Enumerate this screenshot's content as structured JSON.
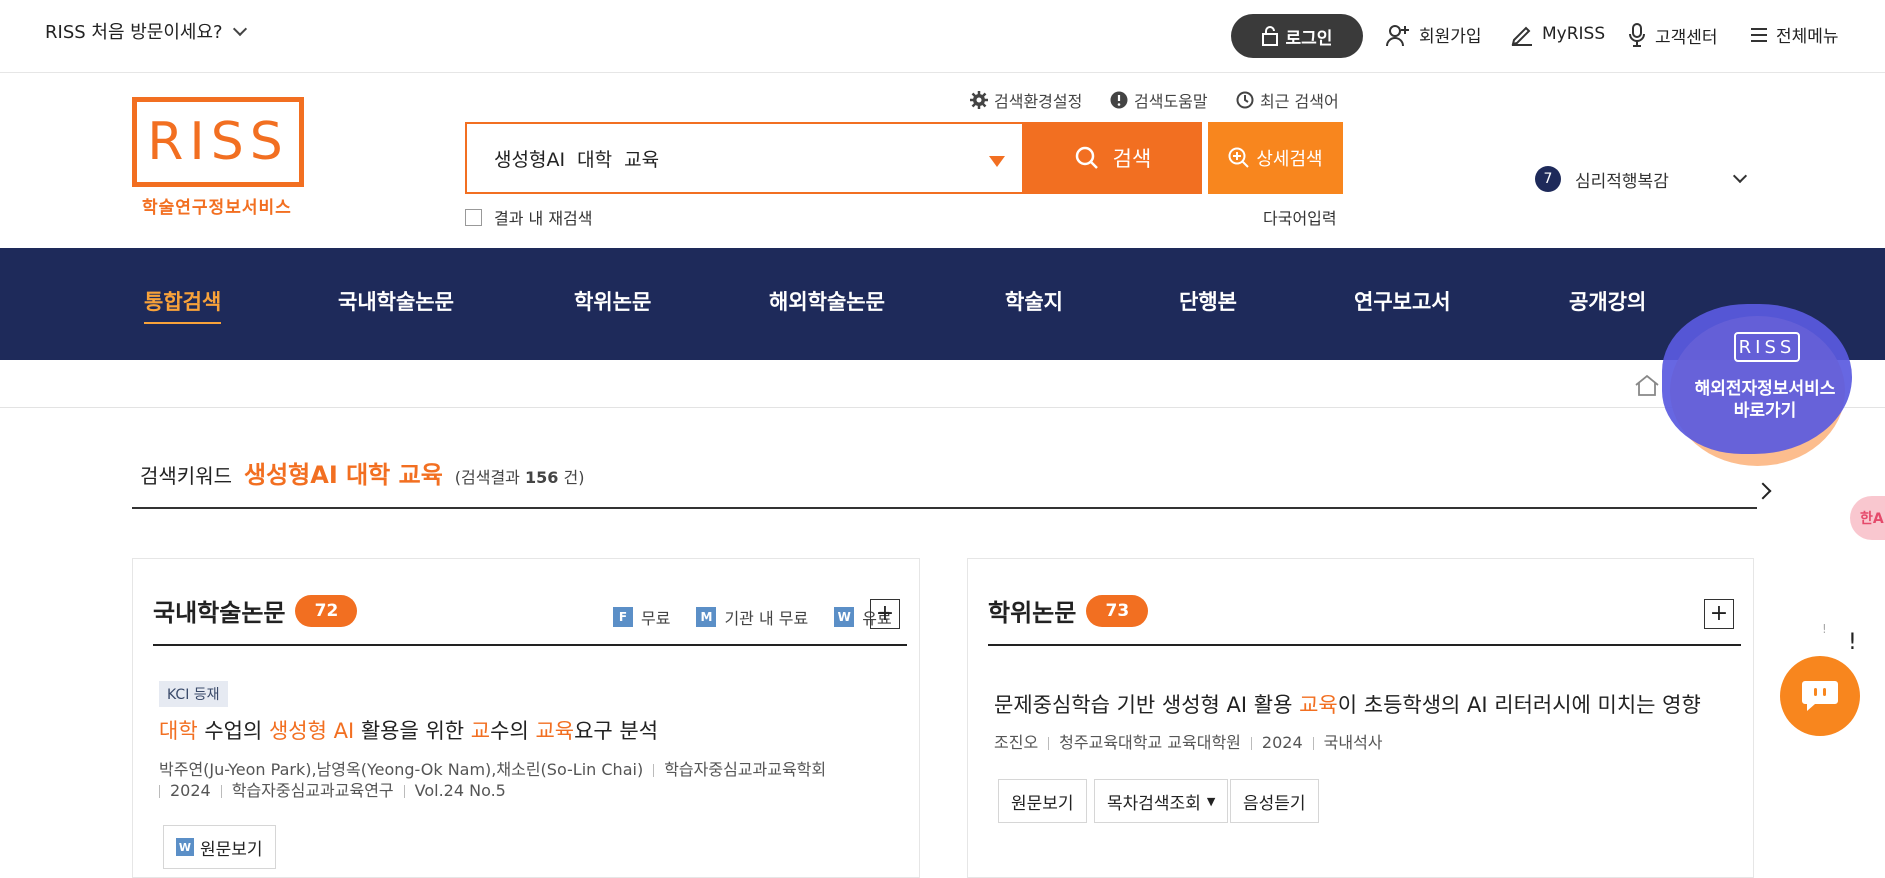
{
  "utility": {
    "first_visit": "RISS 처음 방문이세요?",
    "login": "로그인",
    "signup": "회원가입",
    "myriss": "MyRISS",
    "support": "고객센터",
    "all_menu": "전체메뉴"
  },
  "logo": {
    "letters": "RISS",
    "subtitle": "학술연구정보서비스"
  },
  "search": {
    "settings": "검색환경설정",
    "help": "검색도움말",
    "recent": "최근 검색어",
    "query": "생성형AI  대학  교육",
    "button": "검색",
    "advanced": "상세검색",
    "refine": "결과 내 재검색",
    "multilang": "다국어입력"
  },
  "ranking": {
    "rank": "7",
    "term": "심리적행복감"
  },
  "gnb": [
    {
      "label": "통합검색",
      "active": true
    },
    {
      "label": "국내학술논문",
      "active": false
    },
    {
      "label": "학위논문",
      "active": false
    },
    {
      "label": "해외학술논문",
      "active": false
    },
    {
      "label": "학술지",
      "active": false
    },
    {
      "label": "단행본",
      "active": false
    },
    {
      "label": "연구보고서",
      "active": false
    },
    {
      "label": "공개강의",
      "active": false
    }
  ],
  "banner": {
    "logo": "RISS",
    "line1": "해외전자정보서비스",
    "line2": "바로가기"
  },
  "keyword": {
    "label": "검색키워드",
    "value": "생성형AI 대학 교육",
    "result_prefix": "(검색결과",
    "result_count": "156",
    "result_suffix": "건)"
  },
  "domestic": {
    "title": "국내학술논문",
    "count": "72",
    "legend": [
      {
        "icon": "F",
        "label": "무료"
      },
      {
        "icon": "M",
        "label": "기관 내 무료"
      },
      {
        "icon": "W",
        "label": "유료"
      }
    ],
    "badge": "KCI 등재",
    "paper": {
      "title_parts": [
        {
          "text": "대학",
          "hl": true
        },
        {
          "text": " 수업의 ",
          "hl": false
        },
        {
          "text": "생성형 AI",
          "hl": true
        },
        {
          "text": " 활용을 위한 ",
          "hl": false
        },
        {
          "text": "교",
          "hl": true
        },
        {
          "text": "수의 ",
          "hl": false
        },
        {
          "text": "교육",
          "hl": true
        },
        {
          "text": "요구 분석",
          "hl": false
        }
      ],
      "authors": "박주연(Ju-Yeon Park),남영옥(Yeong-Ok Nam),채소린(So-Lin Chai)",
      "publisher": "학습자중심교과교육학회",
      "year": "2024",
      "journal": "학습자중심교과교육연구",
      "volume": "Vol.24 No.5",
      "view_btn": "원문보기",
      "view_icon": "W"
    }
  },
  "thesis": {
    "title": "학위논문",
    "count": "73",
    "paper": {
      "title_parts": [
        {
          "text": "문제중심학습 기반 생성형 AI 활용 ",
          "hl": false
        },
        {
          "text": "교육",
          "hl": true
        },
        {
          "text": "이 초등학생의 AI 리터러시에 미치는 영향",
          "hl": false
        }
      ],
      "author": "조진오",
      "school": "청주교육대학교 교육대학원",
      "year": "2024",
      "degree": "국내석사",
      "btn_view": "원문보기",
      "btn_toc": "목차검색조회",
      "btn_audio": "음성듣기"
    }
  },
  "side": {
    "pink_label": "한A",
    "bang_small": "!",
    "bang_big": "!"
  },
  "colors": {
    "brand_orange": "#f26f21",
    "nav_navy": "#1e2a5a",
    "nav_active": "#f8a23a"
  }
}
